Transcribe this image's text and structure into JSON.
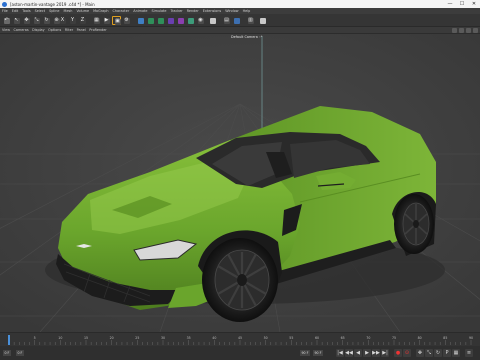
{
  "window": {
    "title": "[aston-martin-vantage 2019 .c4d *] - Main",
    "controls": [
      "—",
      "☐",
      "✕"
    ]
  },
  "menubar": {
    "items": [
      "File",
      "Edit",
      "Tools",
      "Select",
      "Spline",
      "Mesh",
      "Volume",
      "MoGraph",
      "Character",
      "Animate",
      "Simulate",
      "Tracker",
      "Render",
      "Extensions",
      "Window",
      "Help"
    ]
  },
  "toolbar": {
    "buttons": [
      {
        "name": "undo-icon",
        "color": "#6a6a6a",
        "glyph": "↶"
      },
      {
        "name": "live-selection-icon",
        "color": "#4a4a4a",
        "glyph": "↖"
      },
      {
        "name": "move-icon",
        "color": "#4a4a4a",
        "glyph": "✥"
      },
      {
        "name": "scale-icon",
        "color": "#4a4a4a",
        "glyph": "⤡"
      },
      {
        "name": "rotate-icon",
        "color": "#4a4a4a",
        "glyph": "↻"
      },
      {
        "name": "last-tool-icon",
        "color": "#4a4a4a",
        "glyph": "⊕"
      },
      {
        "name": "x-axis-icon",
        "color": "#3d3d3d",
        "glyph": "X"
      },
      {
        "name": "y-axis-icon",
        "color": "#3d3d3d",
        "glyph": "Y"
      },
      {
        "name": "z-axis-icon",
        "color": "#3d3d3d",
        "glyph": "Z"
      },
      {
        "name": "coordinate-system-icon",
        "color": "#4a4a4a",
        "glyph": "▦"
      },
      {
        "name": "render-view-icon",
        "color": "#4a4a4a",
        "glyph": "▶"
      },
      {
        "name": "render-picture-viewer-icon",
        "color": "#4a4a4a",
        "glyph": "▣"
      },
      {
        "name": "render-settings-icon",
        "color": "#4a4a4a",
        "glyph": "⚙"
      },
      {
        "name": "cube-icon",
        "color": "#3f7fc4",
        "glyph": ""
      },
      {
        "name": "pen-icon",
        "color": "#2f8f5a",
        "glyph": ""
      },
      {
        "name": "subdivision-icon",
        "color": "#2f8f5a",
        "glyph": ""
      },
      {
        "name": "array-icon",
        "color": "#6a3fb0",
        "glyph": ""
      },
      {
        "name": "deformer-icon",
        "color": "#8a3fb0",
        "glyph": ""
      },
      {
        "name": "floor-icon",
        "color": "#3d9b7a",
        "glyph": ""
      },
      {
        "name": "camera-icon",
        "color": "#4a4a4a",
        "glyph": "◉"
      },
      {
        "name": "light-icon",
        "color": "#c8c8c8",
        "glyph": ""
      },
      {
        "name": "display-icon",
        "color": "#4a4a4a",
        "glyph": "▤"
      },
      {
        "name": "snap-icon",
        "color": "#3d6fb0",
        "glyph": ""
      },
      {
        "name": "workplane-icon",
        "color": "#4a4a4a",
        "glyph": "▥"
      },
      {
        "name": "python-icon",
        "color": "#c9c9c9",
        "glyph": ""
      }
    ]
  },
  "viewmenu": {
    "items": [
      "View",
      "Cameras",
      "Display",
      "Options",
      "Filter",
      "Panel",
      "ProRender"
    ],
    "camera_label": "Default Camera ◦⁰"
  },
  "timeline": {
    "ticks": [
      "0",
      "5",
      "10",
      "15",
      "20",
      "25",
      "30",
      "35",
      "40",
      "45",
      "50",
      "55",
      "60",
      "65",
      "70",
      "75",
      "80",
      "85",
      "90"
    ]
  },
  "transport": {
    "start_frame": "0 F",
    "current_frame": "0 F",
    "end_frame": "90 F",
    "max_frame": "90 F",
    "buttons": [
      "|◀",
      "◀◀",
      "◀",
      "▶",
      "▶▶",
      "▶|",
      "●",
      "⊙"
    ]
  },
  "colors": {
    "viewport_bg": "#414141",
    "car_body": "#6aa52c",
    "accent_selection": "#e0a020"
  }
}
